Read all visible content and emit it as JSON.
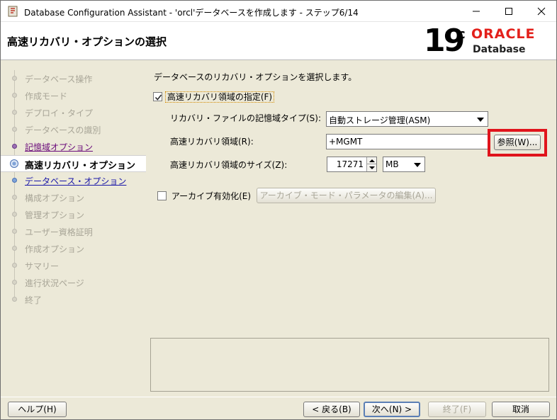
{
  "window": {
    "title": "Database Configuration Assistant - 'orcl'データベースを作成します - ステップ6/14"
  },
  "header": {
    "title": "高速リカバリ・オプションの選択",
    "logo_version": "19",
    "logo_suffix": "c",
    "logo_brand": "ORACLE",
    "logo_product": "Database"
  },
  "sidebar": {
    "steps": [
      {
        "label": "データベース操作",
        "state": "disabled"
      },
      {
        "label": "作成モード",
        "state": "disabled"
      },
      {
        "label": "デプロイ・タイプ",
        "state": "disabled"
      },
      {
        "label": "データベースの識別",
        "state": "disabled"
      },
      {
        "label": "記憶域オプション",
        "state": "visited"
      },
      {
        "label": "高速リカバリ・オプション",
        "state": "current"
      },
      {
        "label": "データベース・オプション",
        "state": "link"
      },
      {
        "label": "構成オプション",
        "state": "disabled"
      },
      {
        "label": "管理オプション",
        "state": "disabled"
      },
      {
        "label": "ユーザー資格証明",
        "state": "disabled"
      },
      {
        "label": "作成オプション",
        "state": "disabled"
      },
      {
        "label": "サマリー",
        "state": "disabled"
      },
      {
        "label": "進行状況ページ",
        "state": "disabled"
      },
      {
        "label": "終了",
        "state": "disabled"
      }
    ]
  },
  "main": {
    "instruction": "データベースのリカバリ・オプションを選択します。",
    "fra_checkbox_label": "高速リカバリ領域の指定(F)",
    "fra_checked": true,
    "storage_type_label": "リカバリ・ファイルの記憶域タイプ(S):",
    "storage_type_value": "自動ストレージ管理(ASM)",
    "fra_location_label": "高速リカバリ領域(R):",
    "fra_location_value": "+MGMT",
    "browse_button": "参照(W)...",
    "fra_size_label": "高速リカバリ領域のサイズ(Z):",
    "fra_size_value": "17271",
    "fra_size_unit": "MB",
    "archive_checkbox_label": "アーカイブ有効化(E)",
    "archive_checked": false,
    "archive_params_button": "アーカイブ・モード・パラメータの編集(A)..."
  },
  "footer": {
    "help": "ヘルプ(H)",
    "back": "< 戻る(B)",
    "next": "次へ(N) >",
    "finish": "終了(F)",
    "cancel": "取消"
  },
  "colors": {
    "highlight": "#e0141c",
    "oracle_red": "#e3201b",
    "link": "#1a17a8",
    "visited": "#6a0a7a"
  }
}
